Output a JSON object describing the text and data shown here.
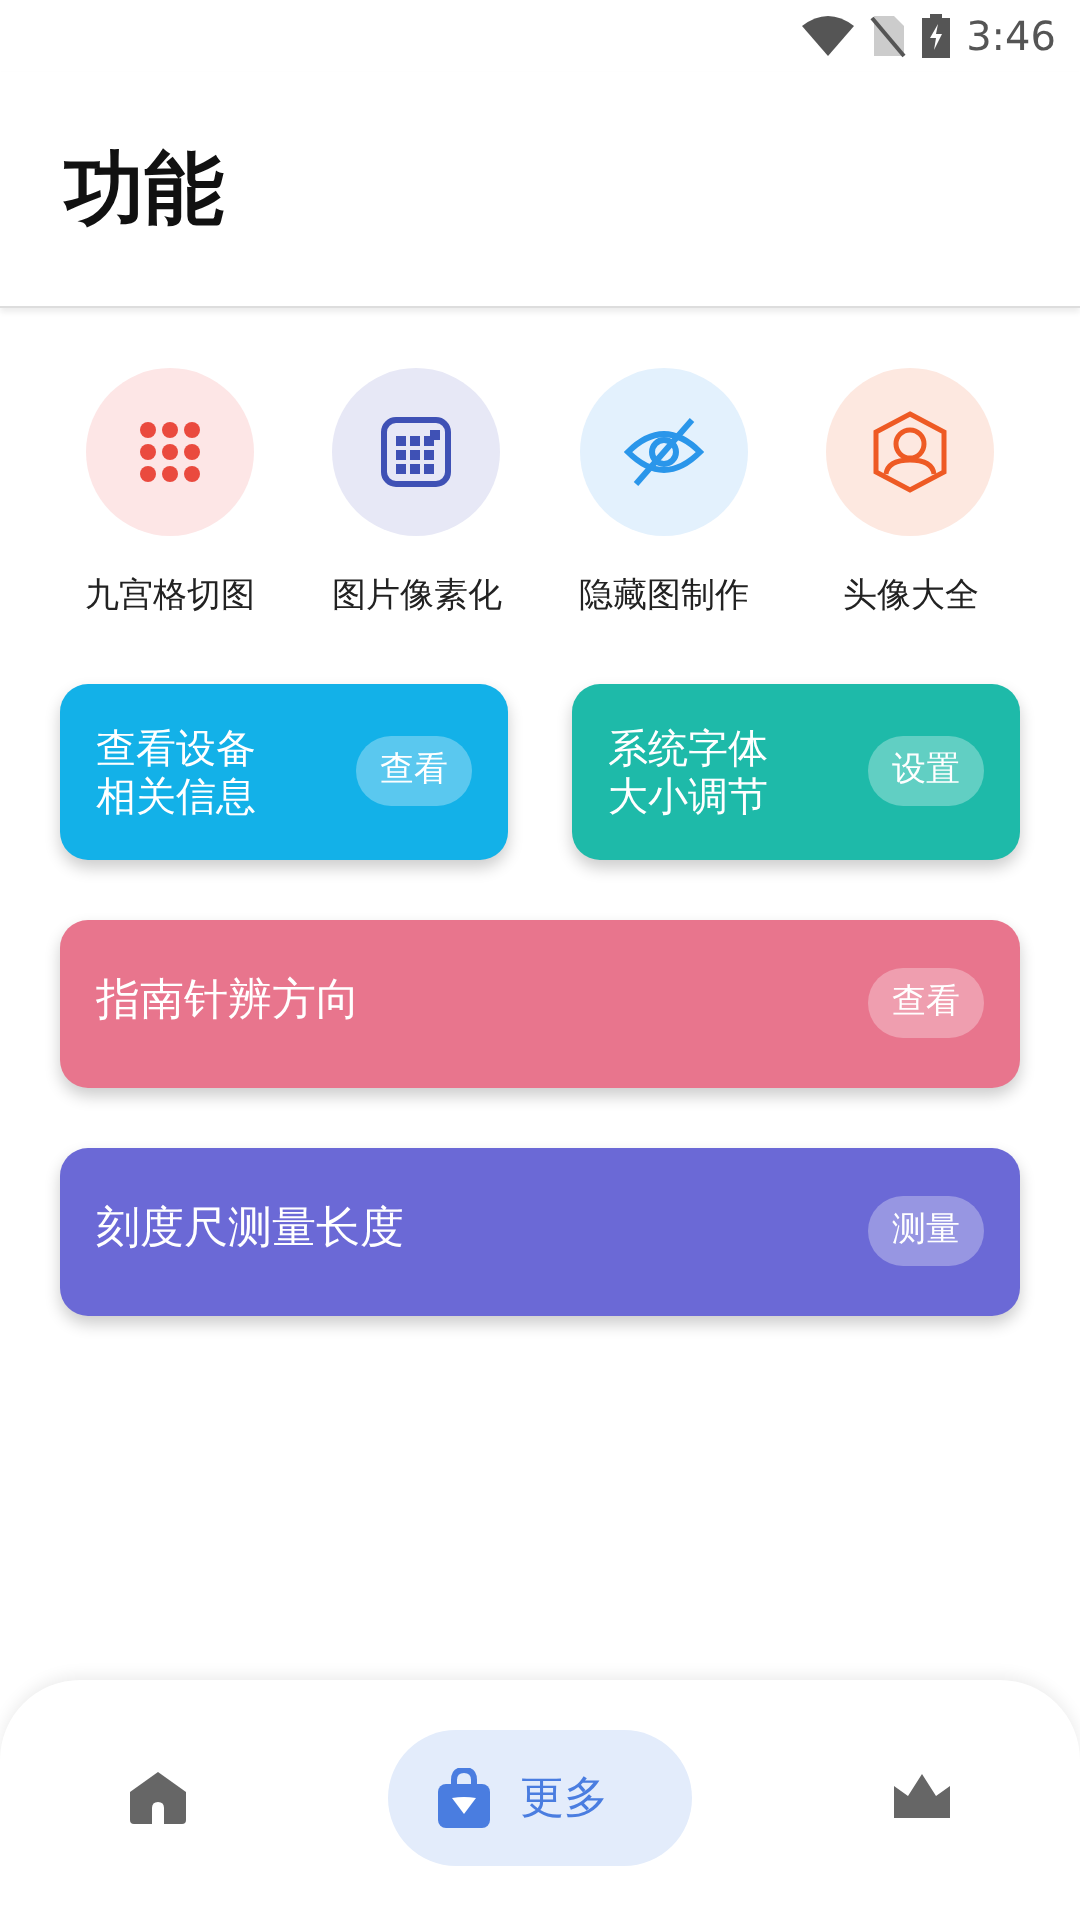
{
  "status_bar": {
    "time": "3:46"
  },
  "header": {
    "title": "功能"
  },
  "tools": [
    {
      "kind": "grid",
      "label": "九宫格切图"
    },
    {
      "kind": "pixel",
      "label": "图片像素化"
    },
    {
      "kind": "hide",
      "label": "隐藏图制作"
    },
    {
      "kind": "avatar",
      "label": "头像大全"
    }
  ],
  "cards": [
    {
      "kind": "half",
      "title": "查看设备相关信息",
      "button": "查看",
      "color": "#13b1e8"
    },
    {
      "kind": "half",
      "title": "系统字体大小调节",
      "button": "设置",
      "color": "#1ebaa9"
    },
    {
      "kind": "full",
      "title": "指南针辨方向",
      "button": "查看",
      "color": "#e8758d"
    },
    {
      "kind": "full",
      "title": "刻度尺测量长度",
      "button": "测量",
      "color": "#6b69d6"
    }
  ],
  "bottom_nav": [
    {
      "kind": "home",
      "selected": false
    },
    {
      "kind": "bag",
      "label": "更多",
      "selected": true
    },
    {
      "kind": "crown",
      "selected": false
    }
  ]
}
